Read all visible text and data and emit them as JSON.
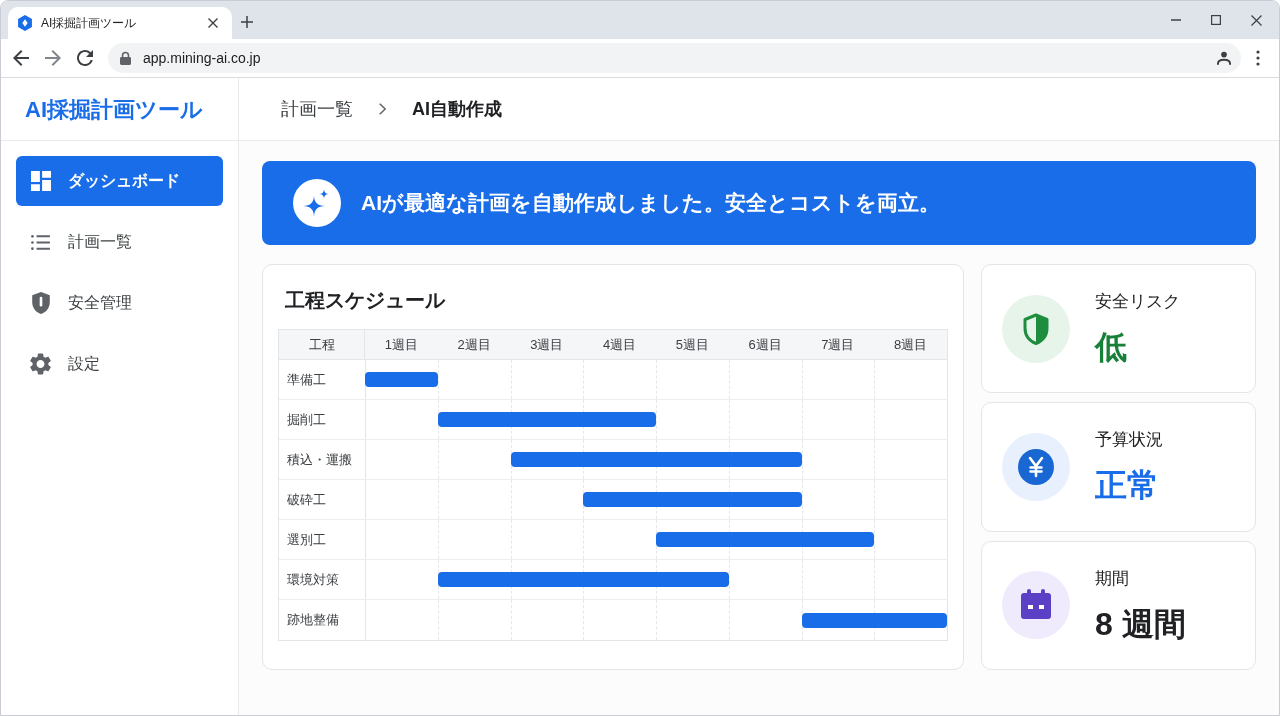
{
  "browser": {
    "tabs": [
      {
        "title": "AI採掘計画ツール",
        "selected": true
      }
    ],
    "url": "app.mining-ai.co.jp"
  },
  "sidebar": {
    "logo": "AI採掘計画ツール",
    "items": [
      {
        "label": "ダッシュボード",
        "kind": "grid",
        "selected": true
      },
      {
        "label": "計画一覧",
        "kind": "list",
        "selected": false
      },
      {
        "label": "安全管理",
        "kind": "shield",
        "selected": false
      },
      {
        "label": "設定",
        "kind": "gear",
        "selected": false
      }
    ]
  },
  "breadcrumb": [
    {
      "label": "計画一覧",
      "current": false
    },
    {
      "label": "AI自動作成",
      "current": true
    }
  ],
  "banner": {
    "message": "AIが最適な計画を自動作成しました。安全とコストを両立。"
  },
  "schedule": {
    "title": "工程スケジュール",
    "columns": [
      "工程",
      "1週目",
      "2週目",
      "3週目",
      "4週目",
      "5週目",
      "6週目",
      "7週目",
      "8週目"
    ],
    "rows": [
      {
        "task": "準備工",
        "weeks": [
          true,
          false,
          false,
          false,
          false,
          false,
          false,
          false
        ]
      },
      {
        "task": "掘削工",
        "weeks": [
          false,
          true,
          true,
          true,
          false,
          false,
          false,
          false
        ]
      },
      {
        "task": "積込・運搬",
        "weeks": [
          false,
          false,
          true,
          true,
          true,
          true,
          false,
          false
        ]
      },
      {
        "task": "破砕工",
        "weeks": [
          false,
          false,
          false,
          true,
          true,
          true,
          false,
          false
        ]
      },
      {
        "task": "選別工",
        "weeks": [
          false,
          false,
          false,
          false,
          true,
          true,
          true,
          false
        ]
      },
      {
        "task": "環境対策",
        "weeks": [
          false,
          true,
          true,
          true,
          true,
          false,
          false,
          false
        ]
      },
      {
        "task": "跡地整備",
        "weeks": [
          false,
          false,
          false,
          false,
          false,
          false,
          true,
          true
        ]
      }
    ]
  },
  "status_cards": [
    {
      "kind": "shield",
      "label": "安全リスク",
      "value": "低",
      "color": "#188038"
    },
    {
      "kind": "yen",
      "label": "予算状況",
      "value": "正常",
      "color": "#1a6de8"
    },
    {
      "kind": "calendar",
      "label": "期間",
      "value": "8 週間",
      "color": "#202124"
    }
  ]
}
